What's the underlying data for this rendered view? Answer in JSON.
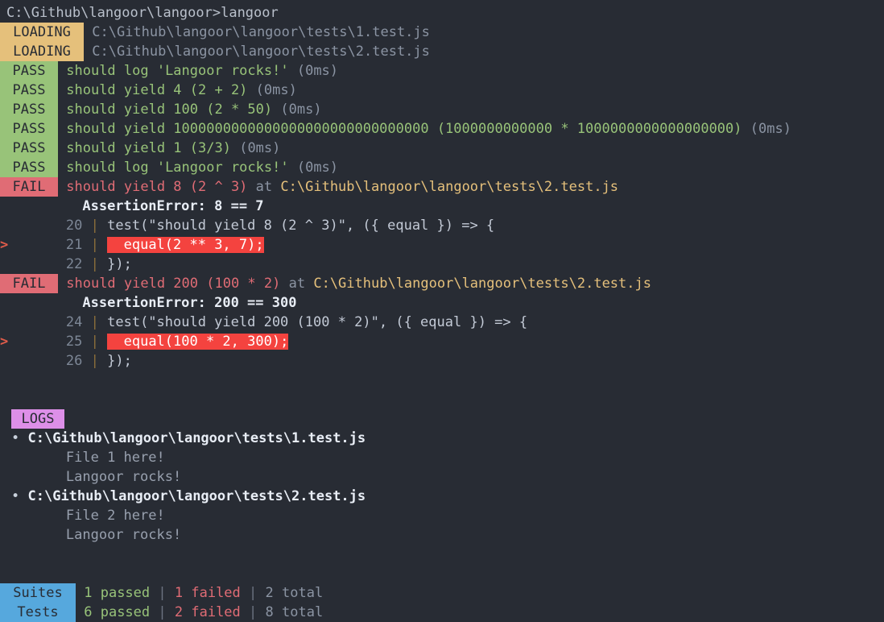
{
  "terminal": {
    "prompt_line": "C:\\Github\\langoor\\langoor>langoor",
    "loading": [
      {
        "badge": "LOADING",
        "path": "C:\\Github\\langoor\\langoor\\tests\\1.test.js"
      },
      {
        "badge": "LOADING",
        "path": "C:\\Github\\langoor\\langoor\\tests\\2.test.js"
      }
    ],
    "results": [
      {
        "badge": "PASS",
        "text": "should log 'Langoor rocks!'",
        "time": "(0ms)"
      },
      {
        "badge": "PASS",
        "text": "should yield 4 (2 + 2)",
        "time": "(0ms)"
      },
      {
        "badge": "PASS",
        "text": "should yield 100 (2 * 50)",
        "time": "(0ms)"
      },
      {
        "badge": "PASS",
        "text": "should yield 1000000000000000000000000000000 (1000000000000 * 1000000000000000000)",
        "time": "(0ms)"
      },
      {
        "badge": "PASS",
        "text": "should yield 1 (3/3)",
        "time": "(0ms)"
      },
      {
        "badge": "PASS",
        "text": "should log 'Langoor rocks!'",
        "time": "(0ms)"
      }
    ],
    "failures": [
      {
        "badge": "FAIL",
        "title": "should yield 8 (2 ^ 3)",
        "at": "at",
        "path": "C:\\Github\\langoor\\langoor\\tests\\2.test.js",
        "error": "AssertionError: 8 == 7",
        "code": [
          {
            "marker": "",
            "lineno": "20",
            "bar": "|",
            "text": "test(\"should yield 8 (2 ^ 3)\", ({ equal }) => {",
            "highlight": false
          },
          {
            "marker": ">",
            "lineno": "21",
            "bar": "|",
            "text": "  equal(2 ** 3, 7);",
            "highlight": true
          },
          {
            "marker": "",
            "lineno": "22",
            "bar": "|",
            "text": "});",
            "highlight": false
          }
        ]
      },
      {
        "badge": "FAIL",
        "title": "should yield 200 (100 * 2)",
        "at": "at",
        "path": "C:\\Github\\langoor\\langoor\\tests\\2.test.js",
        "error": "AssertionError: 200 == 300",
        "code": [
          {
            "marker": "",
            "lineno": "24",
            "bar": "|",
            "text": "test(\"should yield 200 (100 * 2)\", ({ equal }) => {",
            "highlight": false
          },
          {
            "marker": ">",
            "lineno": "25",
            "bar": "|",
            "text": "  equal(100 * 2, 300);",
            "highlight": true
          },
          {
            "marker": "",
            "lineno": "26",
            "bar": "|",
            "text": "});",
            "highlight": false
          }
        ]
      }
    ],
    "logs": {
      "badge": "LOGS",
      "bullet": "•",
      "groups": [
        {
          "file": "C:\\Github\\langoor\\langoor\\tests\\1.test.js",
          "messages": [
            "File 1 here!",
            "Langoor rocks!"
          ]
        },
        {
          "file": "C:\\Github\\langoor\\langoor\\tests\\2.test.js",
          "messages": [
            "File 2 here!",
            "Langoor rocks!"
          ]
        }
      ]
    },
    "summary": {
      "rows": [
        {
          "label": "Suites",
          "passed": "1 passed",
          "sep1": "|",
          "failed": "1 failed",
          "sep2": "|",
          "total": "2 total"
        },
        {
          "label": "Tests",
          "passed": "6 passed",
          "sep1": "|",
          "failed": "2 failed",
          "sep2": "|",
          "total": "8 total"
        }
      ]
    },
    "colors": {
      "background": "#282c34",
      "pass": "#98c379",
      "fail": "#e06c75",
      "loading": "#e5c07b",
      "logs": "#dd8fe8",
      "summary": "#56a8dd",
      "highlight": "#f4433f"
    }
  }
}
